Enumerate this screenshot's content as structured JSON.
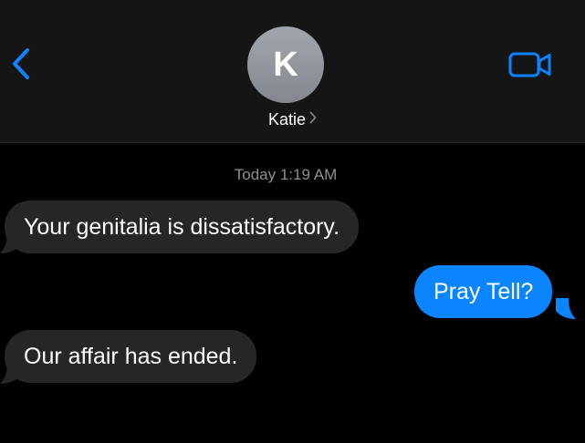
{
  "colors": {
    "background": "#000000",
    "header_bg": "#151515",
    "accent": "#0a84ff",
    "incoming_bubble": "#262628",
    "outgoing_bubble": "#0a84ff",
    "timestamp": "#8e8e93"
  },
  "header": {
    "back_icon": "chevron-left-icon",
    "avatar_initial": "K",
    "contact_name": "Katie",
    "contact_chevron_icon": "chevron-right-icon",
    "video_icon": "video-camera-icon"
  },
  "conversation": {
    "timestamp": "Today 1:19 AM",
    "messages": [
      {
        "direction": "incoming",
        "text": "Your genitalia is dissatisfactory."
      },
      {
        "direction": "outgoing",
        "text": "Pray Tell?"
      },
      {
        "direction": "incoming",
        "text": "Our affair has ended."
      }
    ]
  }
}
